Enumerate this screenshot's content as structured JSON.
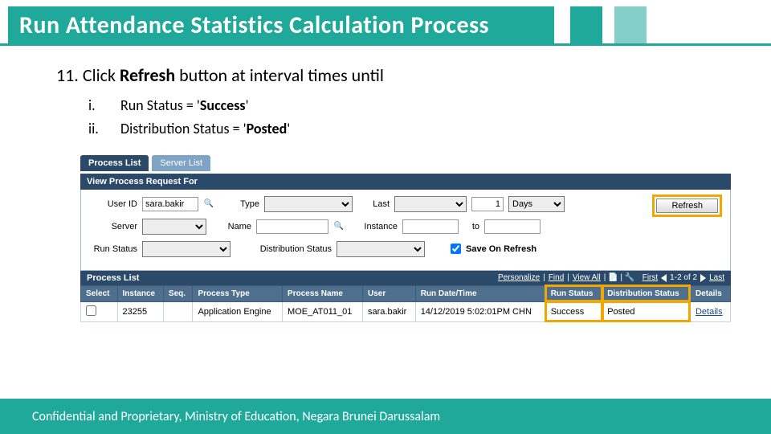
{
  "title": "Run Attendance Statistics Calculation Process",
  "step": {
    "num": "11.",
    "text_before": "Click ",
    "text_bold": "Refresh",
    "text_after": " button at interval times until",
    "sub": [
      {
        "num": "i.",
        "pre": "Run Status = '",
        "bold": "Success",
        "post": "'"
      },
      {
        "num": "ii.",
        "pre": "Distribution Status = '",
        "bold": "Posted",
        "post": "'"
      }
    ]
  },
  "ui": {
    "tabs": {
      "active": "Process List",
      "inactive": "Server List"
    },
    "section1": "View Process Request For",
    "labels": {
      "user": "User ID",
      "type": "Type",
      "last": "Last",
      "days": "Days",
      "server": "Server",
      "name": "Name",
      "instance": "Instance",
      "to": "to",
      "runstatus": "Run Status",
      "diststatus": "Distribution Status",
      "save": "Save On Refresh"
    },
    "values": {
      "user": "sara.bakir",
      "last_n": "1"
    },
    "refresh": "Refresh",
    "section2": "Process List",
    "listnav": {
      "personalize": "Personalize",
      "find": "Find",
      "viewall": "View All",
      "first": "First",
      "range": "1-2 of 2",
      "last": "Last"
    },
    "cols": [
      "Select",
      "Instance",
      "Seq.",
      "Process Type",
      "Process Name",
      "User",
      "Run Date/Time",
      "Run Status",
      "Distribution Status",
      "Details"
    ],
    "row": {
      "instance": "23255",
      "seq": "",
      "ptype": "Application Engine",
      "pname": "MOE_AT011_01",
      "user": "sara.bakir",
      "dt": "14/12/2019  5:02:01PM CHN",
      "rstat": "Success",
      "dstat": "Posted",
      "details": "Details"
    }
  },
  "footer": "Confidential and Proprietary, Ministry of Education, Negara Brunei Darussalam"
}
